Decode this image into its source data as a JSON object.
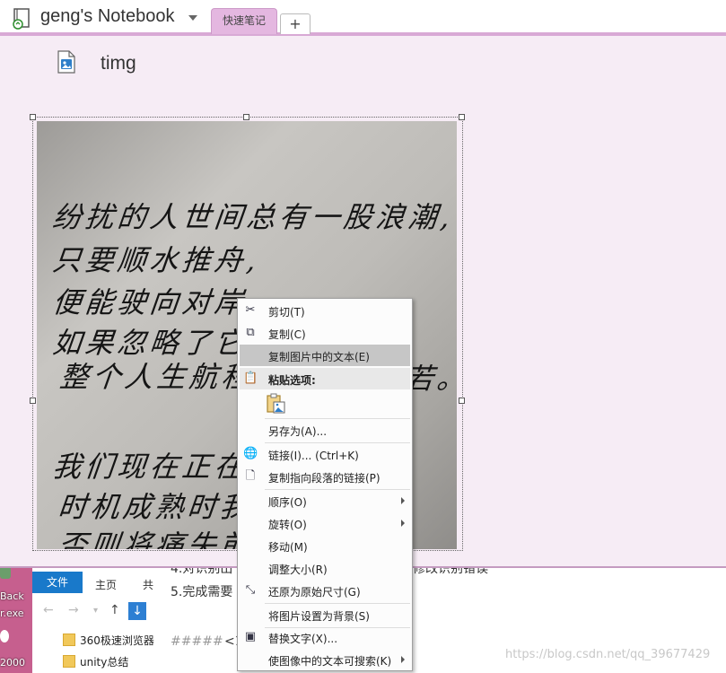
{
  "notebook": {
    "title": "geng's Notebook",
    "section_tab": "快速笔记",
    "new_tab": "+"
  },
  "page": {
    "title": "timg"
  },
  "image_text": [
    "纷扰的人世间总有一股浪潮,",
    "只要顺水推舟,",
    "便能驶向对岸;",
    "如果忽略了它,",
    "整个人生航程势",
    "若。",
    "我们现在正在浩",
    "时机成熟时我们",
    "否则将痛失前"
  ],
  "context_menu": {
    "items": [
      {
        "label": "剪切(T)",
        "icon": "scissors-icon"
      },
      {
        "label": "复制(C)",
        "icon": "copy-icon"
      },
      {
        "label": "复制图片中的文本(E)",
        "icon": ""
      },
      {
        "label": "粘贴选项:",
        "icon": "clipboard-icon"
      },
      {
        "label": "另存为(A)...",
        "icon": ""
      },
      {
        "label": "链接(I)...  (Ctrl+K)",
        "icon": "link-globe-icon"
      },
      {
        "label": "复制指向段落的链接(P)",
        "icon": "link-doc-icon"
      },
      {
        "label": "顺序(O)",
        "icon": ""
      },
      {
        "label": "旋转(O)",
        "icon": ""
      },
      {
        "label": "移动(M)",
        "icon": ""
      },
      {
        "label": "调整大小(R)",
        "icon": ""
      },
      {
        "label": "还原为原始尺寸(G)",
        "icon": "restore-size-icon"
      },
      {
        "label": "将图片设置为背景(S)",
        "icon": ""
      },
      {
        "label": "替换文字(X)...",
        "icon": "alt-text-icon"
      },
      {
        "label": "使图像中的文本可搜索(K)",
        "icon": ""
      }
    ]
  },
  "explorer": {
    "tabs": [
      "文件",
      "主页",
      "共"
    ],
    "folders": [
      "360极速浏览器",
      "unity总结"
    ]
  },
  "desktop": {
    "labels": [
      "Back",
      "r.exe",
      "2000"
    ]
  },
  "background_doc": {
    "line4": "4.对识别出",
    "line4_tail": "修改识别错误",
    "line5": "5.完成需要",
    "heading": "#####",
    "heading_tail": "<1"
  },
  "watermark": "https://blog.csdn.net/qq_39677429",
  "colors": {
    "accent": "#d8a9d5",
    "tab_active": "#e4b7e0",
    "page_bg": "#f6ecf5",
    "file_tab": "#1979ca",
    "menu_highlight": "#c6c6c6"
  }
}
